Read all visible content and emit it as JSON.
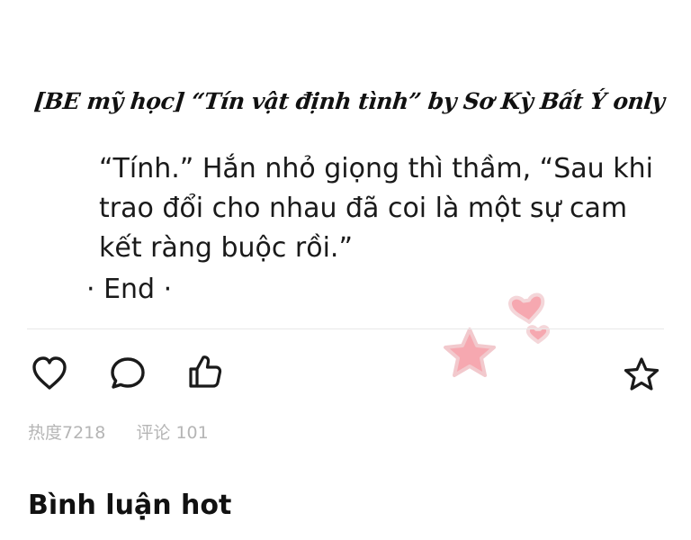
{
  "post": {
    "watermark": "[BE mỹ học] “Tín vật định tình” by Sơ Kỳ Bất Ý only",
    "paragraph": "“Tính.” Hắn nhỏ giọng thì thầm, “Sau khi trao đổi cho nhau đã coi là một sự cam kết ràng buộc rồi.”",
    "end_mark": "· End ·"
  },
  "actions": {
    "like_icon": "heart-icon",
    "comment_icon": "comment-bubble-icon",
    "thumbs_icon": "thumbs-up-icon",
    "favorite_icon": "star-icon"
  },
  "stats": {
    "heat": "热度7218",
    "comments": "评论 101"
  },
  "comments_section": {
    "title": "Bình luận hot"
  },
  "sticker": {
    "icon": "pink-star-hearts-sticker",
    "colors": [
      "#f4a6ad",
      "#fbd3d6"
    ]
  }
}
